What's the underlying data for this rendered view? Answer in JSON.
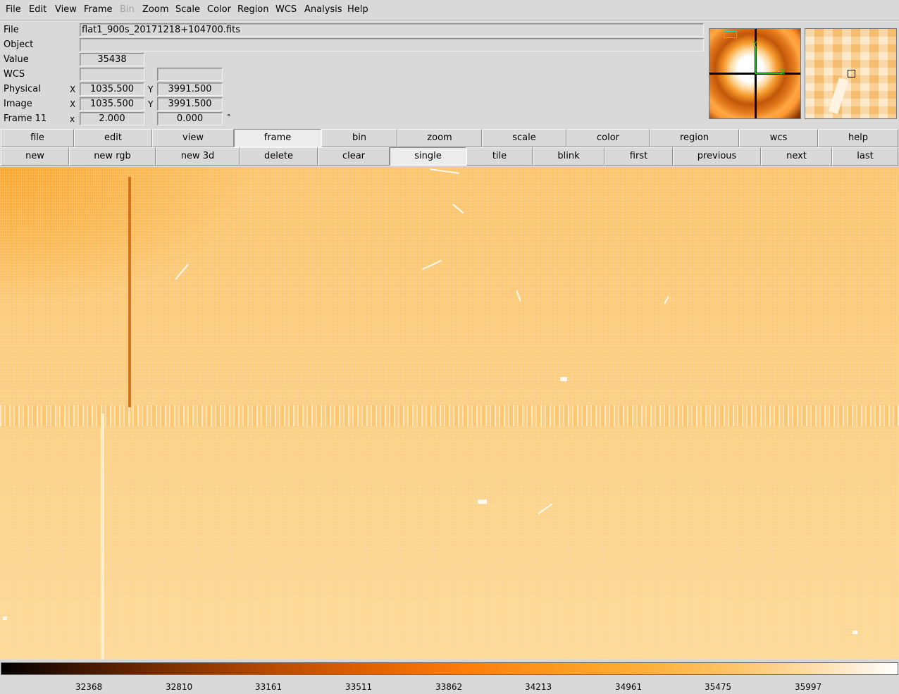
{
  "menubar": [
    "File",
    "Edit",
    "View",
    "Frame",
    "Bin",
    "Zoom",
    "Scale",
    "Color",
    "Region",
    "WCS",
    "Analysis",
    "Help"
  ],
  "menubar_disabled": [
    "Bin"
  ],
  "info": {
    "file_label": "File",
    "file_value": "flat1_900s_20171218+104700.fits",
    "object_label": "Object",
    "object_value": "",
    "value_label": "Value",
    "value_value": "35438",
    "wcs_label": "WCS",
    "wcs_x": "",
    "wcs_y": "",
    "physical_label": "Physical",
    "physical_axis_x": "X",
    "physical_x": "1035.500",
    "physical_axis_y": "Y",
    "physical_y": "3991.500",
    "image_label": "Image",
    "image_axis_x": "X",
    "image_x": "1035.500",
    "image_axis_y": "Y",
    "image_y": "3991.500",
    "frame_label": "Frame 11",
    "frame_axis": "x",
    "frame_zoom": "2.000",
    "frame_angle": "0.000",
    "frame_angle_unit": "°"
  },
  "panner": {
    "label_x": "X",
    "label_y": "Y"
  },
  "main_buttons": [
    "file",
    "edit",
    "view",
    "frame",
    "bin",
    "zoom",
    "scale",
    "color",
    "region",
    "wcs",
    "help"
  ],
  "main_active": "frame",
  "frame_buttons": [
    "new",
    "new rgb",
    "new 3d",
    "delete",
    "clear",
    "single",
    "tile",
    "blink",
    "first",
    "previous",
    "next",
    "last"
  ],
  "frame_active": "single",
  "colorbar": {
    "colormap": "heat",
    "ticks": [
      "32368",
      "32810",
      "33161",
      "33511",
      "33862",
      "34213",
      "34961",
      "35475",
      "35997"
    ]
  }
}
